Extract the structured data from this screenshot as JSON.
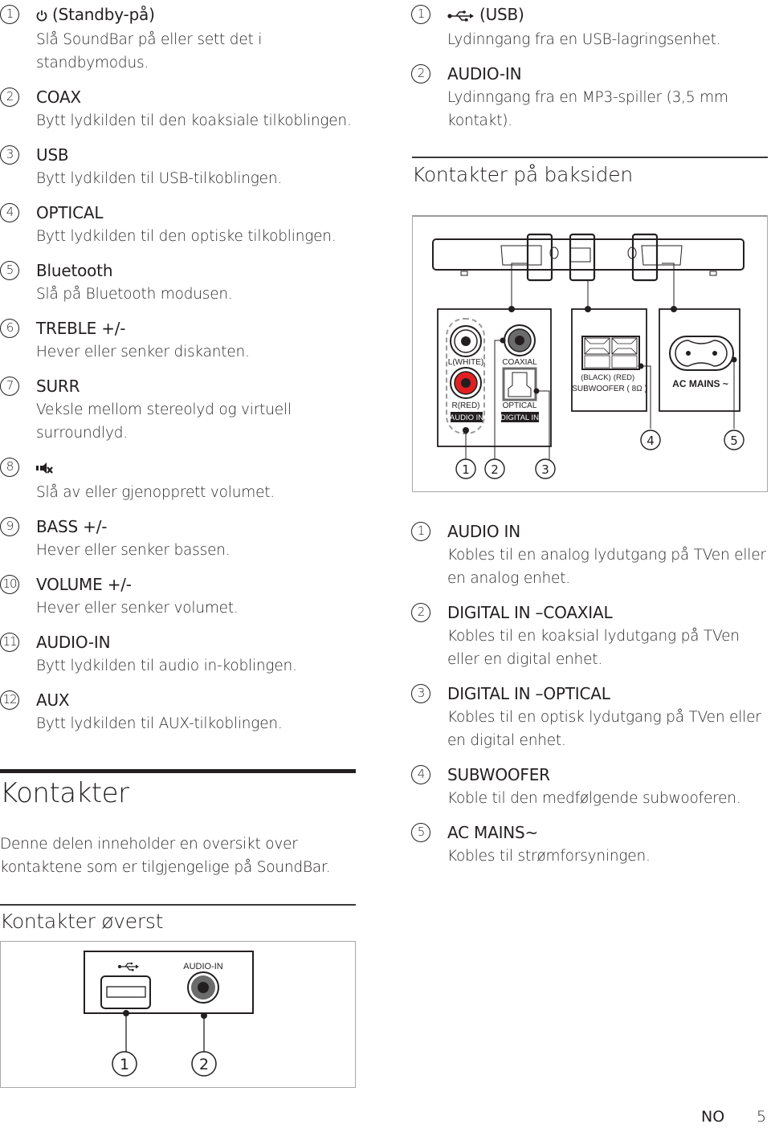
{
  "left_list": [
    {
      "num": "1",
      "icon": "power-icon",
      "title": "(Standby-på)",
      "desc": "Slå SoundBar på eller sett det i standbymodus."
    },
    {
      "num": "2",
      "title": "COAX",
      "desc": "Bytt lydkilden til den koaksiale tilkoblingen."
    },
    {
      "num": "3",
      "title": "USB",
      "desc": "Bytt lydkilden til USB-tilkoblingen."
    },
    {
      "num": "4",
      "title": "OPTICAL",
      "desc": "Bytt lydkilden til den optiske tilkoblingen."
    },
    {
      "num": "5",
      "title": "Bluetooth",
      "desc": "Slå på Bluetooth modusen."
    },
    {
      "num": "6",
      "title": "TREBLE +/-",
      "desc": "Hever eller senker diskanten."
    },
    {
      "num": "7",
      "title": "SURR",
      "desc": "Veksle mellom stereolyd og virtuell surroundlyd."
    },
    {
      "num": "8",
      "icon": "mute-icon",
      "title": "",
      "desc": "Slå av eller gjenopprett volumet."
    },
    {
      "num": "9",
      "title": "BASS +/-",
      "desc": "Hever eller senker bassen."
    },
    {
      "num": "10",
      "title": "VOLUME +/-",
      "desc": "Hever eller senker volumet."
    },
    {
      "num": "11",
      "title": "AUDIO-IN",
      "desc": "Bytt lydkilden til audio in-koblingen."
    },
    {
      "num": "12",
      "title": "AUX",
      "desc": "Bytt lydkilden til AUX-tilkoblingen."
    }
  ],
  "section": {
    "title": "Kontakter",
    "intro": "Denne delen inneholder en oversikt over kontaktene som er tilgjengelige på SoundBar."
  },
  "top_connectors": {
    "heading": "Kontakter øverst",
    "figure": {
      "usb_symbol": "usb-icon",
      "audio_in_label": "AUDIO-IN",
      "callouts": [
        "1",
        "2"
      ]
    },
    "items": [
      {
        "num": "1",
        "icon": "usb-icon",
        "title": "(USB)",
        "desc": "Lydinngang fra en USB-lagringsenhet."
      },
      {
        "num": "2",
        "title": "AUDIO-IN",
        "desc": "Lydinngang fra en MP3-spiller (3,5 mm kontakt)."
      }
    ]
  },
  "back_connectors": {
    "heading": "Kontakter på baksiden",
    "figure": {
      "l_white": "L(WHITE)",
      "r_red": "R(RED)",
      "audio_in": "AUDIO IN",
      "coaxial": "COAXIAL",
      "optical": "OPTICAL",
      "digital_in": "DIGITAL IN",
      "black": "(BLACK)",
      "red": "(RED)",
      "subwoofer": "SUBWOOFER ( 8Ω )",
      "ac_mains": "AC MAINS ~",
      "callouts": [
        "1",
        "2",
        "3",
        "4",
        "5"
      ]
    },
    "items": [
      {
        "num": "1",
        "title": "AUDIO IN",
        "desc": "Kobles til en analog lydutgang på TVen eller en analog enhet."
      },
      {
        "num": "2",
        "title": "DIGITAL IN –COAXIAL",
        "desc": "Kobles til en koaksial lydutgang på TVen eller en digital enhet."
      },
      {
        "num": "3",
        "title": "DIGITAL IN –OPTICAL",
        "desc": "Kobles til en optisk lydutgang på TVen eller en digital enhet."
      },
      {
        "num": "4",
        "title": "SUBWOOFER",
        "desc": "Koble til den medfølgende subwooferen."
      },
      {
        "num": "5",
        "title": "AC MAINS~",
        "desc": "Kobles til strømforsyningen."
      }
    ]
  },
  "footer": {
    "lang": "NO",
    "page": "5"
  },
  "colors": {
    "red_jack": "#e02020",
    "text": "#231f20",
    "gray_jack": "#6b6b6b"
  }
}
